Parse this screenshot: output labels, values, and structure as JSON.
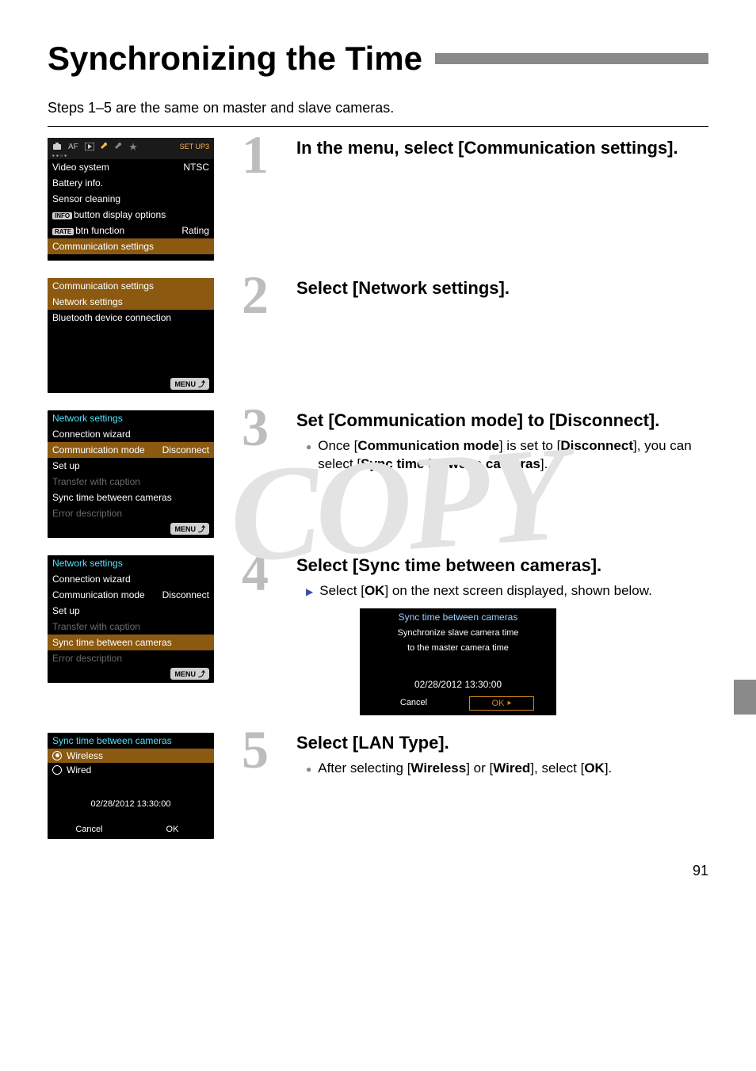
{
  "title": "Synchronizing the Time",
  "note": "Steps 1–5 are the same on master and slave cameras.",
  "page_number": "91",
  "watermark": "COPY",
  "menu_label": "MENU",
  "steps": [
    {
      "num": "1",
      "title": "In the menu, select [Communication settings].",
      "thumb": {
        "tabbar": {
          "af": "AF",
          "setup": "SET UP3"
        },
        "rows": [
          {
            "left": "Video system",
            "right": "NTSC"
          },
          {
            "left": "Battery info."
          },
          {
            "left": "Sensor cleaning"
          },
          {
            "left_badge": "INFO",
            "left": "button display options"
          },
          {
            "left_badge": "RATE",
            "left": "btn function",
            "right": "Rating"
          },
          {
            "left": "Communication settings",
            "hi": true
          }
        ]
      }
    },
    {
      "num": "2",
      "title": "Select [Network settings].",
      "thumb": {
        "header": "Communication settings",
        "rows": [
          {
            "left": "Network settings",
            "hi": true
          },
          {
            "left": "Bluetooth device connection"
          }
        ]
      }
    },
    {
      "num": "3",
      "title": "Set [Communication mode] to [Disconnect].",
      "bullets": [
        {
          "type": "dot",
          "html": "Once [<b>Communication mode</b>] is set to [<b>Disconnect</b>], you can select [<b>Sync time between cameras</b>]."
        }
      ],
      "thumb": {
        "header": "Network settings",
        "rows": [
          {
            "left": "Connection wizard"
          },
          {
            "left": "Communication mode",
            "right": "Disconnect",
            "hi": true
          },
          {
            "left": "Set up"
          },
          {
            "left": "Transfer with caption",
            "gray": true
          },
          {
            "left": "Sync time between cameras"
          },
          {
            "left": "Error description",
            "gray": true
          }
        ]
      }
    },
    {
      "num": "4",
      "title": "Select [Sync time between cameras].",
      "bullets": [
        {
          "type": "arrow",
          "html": "Select [<b>OK</b>] on the next screen displayed, shown below."
        }
      ],
      "thumb": {
        "header": "Network settings",
        "rows": [
          {
            "left": "Connection wizard"
          },
          {
            "left": "Communication mode",
            "right": "Disconnect"
          },
          {
            "left": "Set up"
          },
          {
            "left": "Transfer with caption",
            "gray": true
          },
          {
            "left": "Sync time between cameras",
            "hi": true
          },
          {
            "left": "Error description",
            "gray": true
          }
        ]
      },
      "dialog": {
        "title": "Sync time between cameras",
        "msg1": "Synchronize slave camera time",
        "msg2": "to the master camera time",
        "time": "02/28/2012 13:30:00",
        "cancel": "Cancel",
        "ok": "OK"
      }
    },
    {
      "num": "5",
      "title": "Select [LAN Type].",
      "bullets": [
        {
          "type": "dot",
          "html": "After selecting [<b>Wireless</b>] or [<b>Wired</b>], select [<b>OK</b>]."
        }
      ],
      "thumb_lan": {
        "title": "Sync time between cameras",
        "wireless": "Wireless",
        "wired": "Wired",
        "time": "02/28/2012 13:30:00",
        "cancel": "Cancel",
        "ok": "OK"
      }
    }
  ]
}
